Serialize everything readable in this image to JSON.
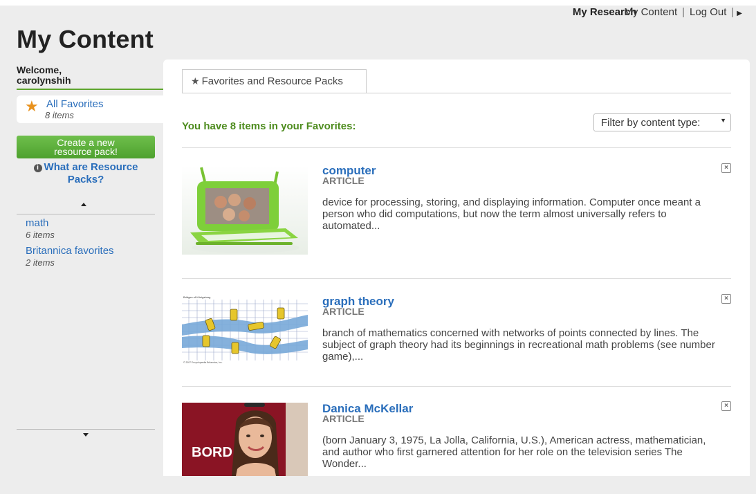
{
  "header": {
    "nav_research": "My Research",
    "nav_content": "My Content",
    "nav_separator": "|",
    "nav_logout": "Log Out",
    "nav_end": "|"
  },
  "page_title": "My Content",
  "sidebar": {
    "welcome_line1": "Welcome,",
    "welcome_line2": "carolynshih",
    "all_favorites": {
      "label": "All Favorites",
      "count": "8 items"
    },
    "create_button": {
      "line1": "Create a new",
      "line2": "resource pack!"
    },
    "what_link": {
      "line1": "What are Resource",
      "line2": "Packs?"
    },
    "packs": [
      {
        "name": "math",
        "count": "6 items"
      },
      {
        "name": "Britannica favorites",
        "count": "2 items"
      }
    ]
  },
  "main": {
    "tab_label": "Favorites and Resource Packs",
    "summary": "You have 8 items in your Favorites:",
    "filter_selected": "Filter by content type:",
    "items": [
      {
        "title": "computer",
        "type": "ARTICLE",
        "description": "device for processing, storing, and displaying information. Computer once meant a person who did computations, but now the term almost universally refers to automated..."
      },
      {
        "title": "graph theory",
        "type": "ARTICLE",
        "description": "branch of mathematics concerned with networks of points connected by lines. The subject of graph theory had its beginnings in recreational math problems (see number game),..."
      },
      {
        "title": "Danica McKellar",
        "type": "ARTICLE",
        "description": "(born January 3, 1975, La Jolla, California, U.S.), American actress, mathematician, and author who first garnered attention for her role on the television series The Wonder..."
      }
    ],
    "thumb_text": {
      "graph_caption": "Bridges of Königsberg",
      "graph_credit": "© 2007 Encyclopædia Britannica, Inc.",
      "sign_text": "BORD"
    }
  },
  "colors": {
    "accent_green": "#5ea52e",
    "link_blue": "#2a6ebb",
    "star_orange": "#e8911c"
  }
}
